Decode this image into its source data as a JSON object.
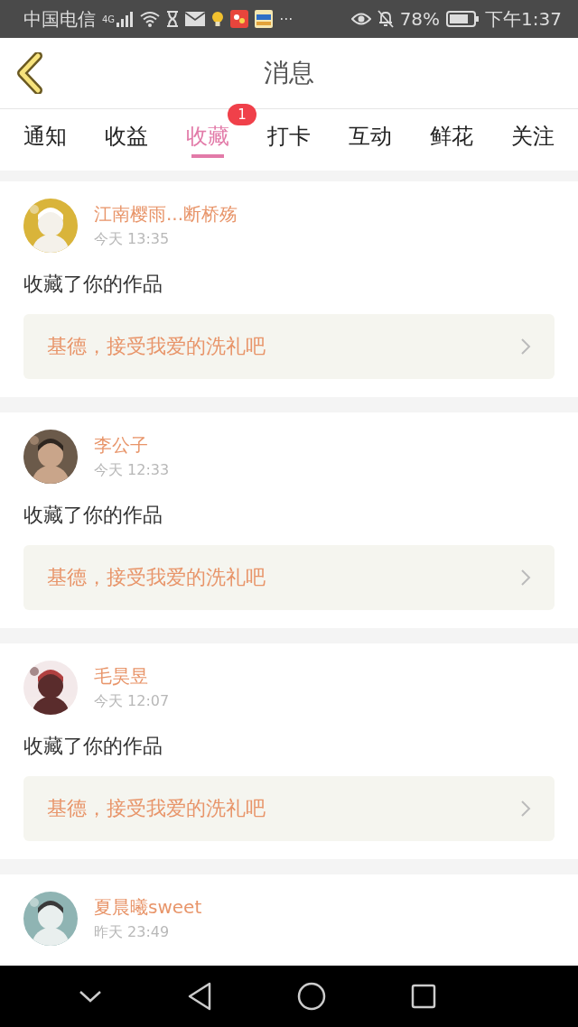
{
  "status_bar": {
    "carrier": "中国电信",
    "network": "4G",
    "more": "···",
    "battery": "78%",
    "time": "下午1:37"
  },
  "header": {
    "title": "消息"
  },
  "tabs": [
    {
      "label": "通知",
      "selected": false
    },
    {
      "label": "收益",
      "selected": false
    },
    {
      "label": "收藏",
      "selected": true,
      "badge": "1"
    },
    {
      "label": "打卡",
      "selected": false
    },
    {
      "label": "互动",
      "selected": false
    },
    {
      "label": "鲜花",
      "selected": false
    },
    {
      "label": "关注",
      "selected": false
    }
  ],
  "messages": [
    {
      "name": "江南樱雨...断桥殇",
      "time": "今天 13:35",
      "text": "收藏了你的作品",
      "work": "基德，接受我爱的洗礼吧"
    },
    {
      "name": "李公子",
      "time": "今天 12:33",
      "text": "收藏了你的作品",
      "work": "基德，接受我爱的洗礼吧"
    },
    {
      "name": "毛昊昱",
      "time": "今天 12:07",
      "text": "收藏了你的作品",
      "work": "基德，接受我爱的洗礼吧"
    },
    {
      "name": "夏晨曦sweet",
      "time": "昨天 23:49"
    }
  ]
}
